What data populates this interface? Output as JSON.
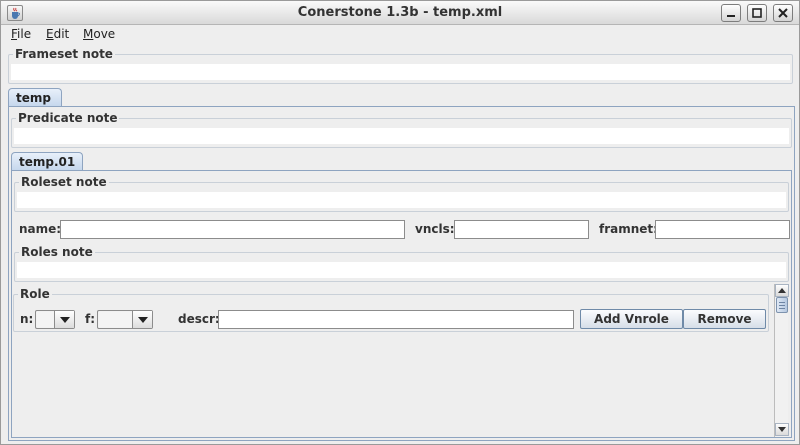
{
  "window": {
    "title": "Conerstone 1.3b - temp.xml"
  },
  "menu": {
    "items": [
      "File",
      "Edit",
      "Move"
    ]
  },
  "frameset": {
    "note_label": "Frameset note"
  },
  "predicate_tab": {
    "label": "temp",
    "note_label": "Predicate note"
  },
  "roleset_tab": {
    "label": "temp.01",
    "note_label": "Roleset note",
    "name_label": "name:",
    "name_value": "",
    "vncls_label": "vncls:",
    "vncls_value": "",
    "framnet_label": "framnet:",
    "framnet_value": "",
    "roles_note_label": "Roles note"
  },
  "role": {
    "title": "Role",
    "n_label": "n:",
    "n_value": "",
    "f_label": "f:",
    "f_value": "",
    "descr_label": "descr:",
    "descr_value": "",
    "add_vnrole_label": "Add Vnrole",
    "remove_label": "Remove"
  },
  "icons": {
    "app": "java-coffee-cup-icon",
    "minimize": "minimize-icon",
    "maximize": "maximize-icon",
    "close": "close-icon",
    "dropdown": "chevron-down-icon",
    "scroll_up": "arrow-up-icon",
    "scroll_down": "arrow-down-icon"
  }
}
